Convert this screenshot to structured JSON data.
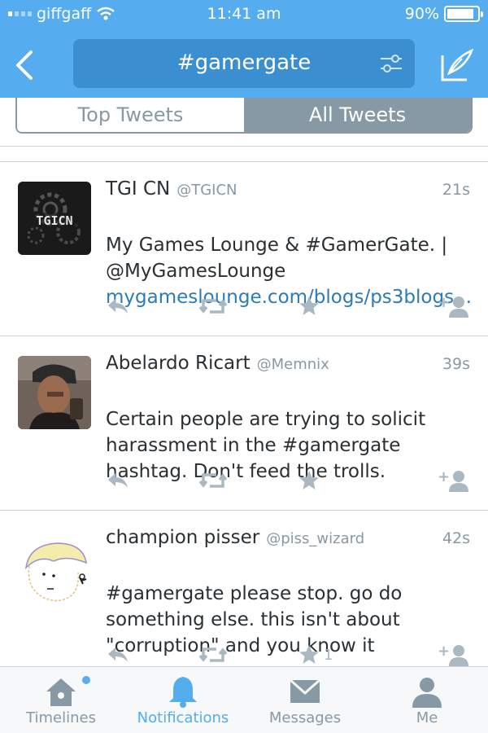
{
  "status_bar": {
    "carrier": "giffgaff",
    "time": "11:41 am",
    "battery": "90%",
    "battery_level": 0.9
  },
  "nav": {
    "back_icon": "chevron-left-icon",
    "search_query": "#gamergate",
    "filter_icon": "sliders-icon",
    "compose_icon": "compose-icon"
  },
  "segments": [
    {
      "label": "Top Tweets",
      "selected": false
    },
    {
      "label": "All Tweets",
      "selected": true
    }
  ],
  "tweets": [
    {
      "name": "TGI CN",
      "handle": "@TGICN",
      "age": "21s",
      "text": "My Games Lounge & #GamerGate. |\n@MyGamesLounge",
      "link": "mygameslounge.com/blogs/ps3blogs...",
      "avatar_text": "TGICN",
      "favorites": ""
    },
    {
      "name": "Abelardo Ricart",
      "handle": "@Memnix",
      "age": "39s",
      "text": "Certain people are trying to solicit harassment in the #gamergate hashtag. Don't feed the trolls.",
      "link": "",
      "avatar_text": "",
      "favorites": ""
    },
    {
      "name": "champion pisser",
      "handle": "@piss_wizard",
      "age": "42s",
      "text": "#gamergate please stop. go do something else. this isn't about \"corruption\" and you know it",
      "link": "",
      "avatar_text": "",
      "favorites": "1"
    }
  ],
  "tabbar": [
    {
      "label": "Timelines",
      "icon": "home-icon",
      "active": false,
      "has_badge": true
    },
    {
      "label": "Notifications",
      "icon": "bell-icon",
      "active": true,
      "has_badge": false
    },
    {
      "label": "Messages",
      "icon": "envelope-icon",
      "active": false,
      "has_badge": false
    },
    {
      "label": "Me",
      "icon": "person-icon",
      "active": false,
      "has_badge": false
    }
  ],
  "colors": {
    "brand": "#55acee",
    "search_bg": "#3b8fd0",
    "muted": "#8899a6",
    "link": "#2b7bb9"
  }
}
